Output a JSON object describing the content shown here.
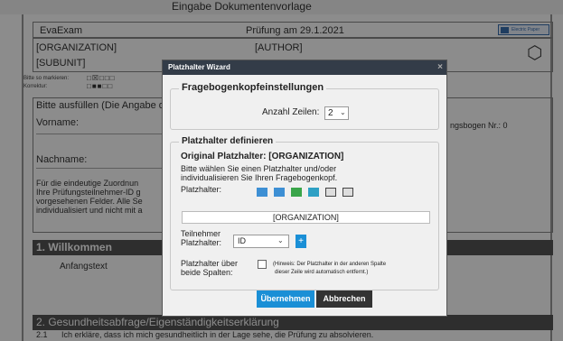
{
  "doc": {
    "top_title": "Eingabe Dokumentenvorlage",
    "app_name": "EvaExam",
    "exam_title": "Prüfung am 29.1.2021",
    "logo_text": "Electric Paper",
    "org_placeholder": "[ORGANIZATION]",
    "author_placeholder": "[AUTHOR]",
    "subunit_placeholder": "[SUBUNIT]",
    "mark_label": "Bitte so markieren:",
    "correction_label": "Korrektur:",
    "instruction": "Bitte ausfüllen (Die Angabe d",
    "sheet_no": "ngsbogen Nr.: 0",
    "first_name_label": "Vorname:",
    "last_name_label": "Nachname:",
    "paragraph": [
      "Für die eindeutige Zuordnun",
      "Ihre Prüfungsteilnehmer-ID g",
      "vorgesehenen Felder. Alle Se",
      "individualisiert und nicht mit a"
    ],
    "section1": "1. Willkommen",
    "section1_text": "Anfangstext",
    "section2": "2. Gesundheitsabfrage/Eigenständigkeitserklärung",
    "item_no": "2.1",
    "item_text": "Ich erkläre, dass ich mich gesundheitlich in der Lage sehe, die Prüfung zu absolvieren."
  },
  "dialog": {
    "title": "Platzhalter Wizard",
    "close_label": "×",
    "group1_title": "Fragebogenkopfeinstellungen",
    "rows_label": "Anzahl Zeilen:",
    "rows_value": "2",
    "group2_title": "Platzhalter definieren",
    "original_label": "Original Platzhalter: [ORGANIZATION]",
    "instruction_line1": "Bitte wählen Sie einen Platzhalter und/oder",
    "instruction_line2": "individualisieren Sie Ihren Fragebogenkopf.",
    "placeholder_label": "Platzhalter:",
    "placeholder_value": "[ORGANIZATION]",
    "participant_label_1": "Teilnehmer",
    "participant_label_2": "Platzhalter:",
    "participant_value": "ID",
    "add_label": "+",
    "both_cols_label_1": "Platzhalter über",
    "both_cols_label_2": "beide Spalten:",
    "hint_line1": "(Hinweis: Der Platzhalter in der anderen Spalte",
    "hint_line2": "dieser Zeile wird automatisch entfernt.)",
    "apply_label": "Übernehmen",
    "cancel_label": "Abbrechen"
  },
  "colors": {
    "accent": "#1a8fd6",
    "dark_button": "#333333",
    "titlebar": "#333c48"
  }
}
